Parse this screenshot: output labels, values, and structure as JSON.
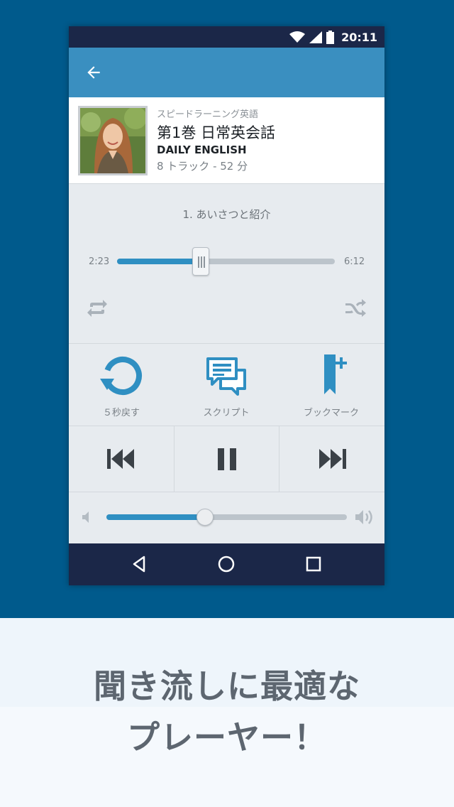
{
  "status_bar": {
    "time": "20:11",
    "icons": [
      "wifi-icon",
      "signal-icon",
      "battery-icon"
    ]
  },
  "app_bar": {
    "back_icon": "arrow-left-icon"
  },
  "album": {
    "series": "スピードラーニング英語",
    "title": "第1巻 日常英会話",
    "subtitle": "DAILY ENGLISH",
    "meta": "8 トラック - 52 分"
  },
  "player": {
    "track_name": "1. あいさつと紹介",
    "elapsed": "2:23",
    "total": "6:12",
    "progress_fraction": 0.385,
    "volume_fraction": 0.41,
    "repeat_icon": "repeat-icon",
    "shuffle_icon": "shuffle-icon"
  },
  "actions": [
    {
      "label": "５秒戻す",
      "icon": "replay-5-icon"
    },
    {
      "label": "スクリプト",
      "icon": "script-chat-icon"
    },
    {
      "label": "ブックマーク",
      "icon": "bookmark-add-icon"
    }
  ],
  "transport": {
    "prev_icon": "skip-previous-icon",
    "pause_icon": "pause-icon",
    "next_icon": "skip-next-icon"
  },
  "nav_bar": {
    "icons": [
      "nav-back-icon",
      "nav-home-icon",
      "nav-recents-icon"
    ]
  },
  "promo": {
    "line1": "聞き流しに最適な",
    "line2": "プレーヤー！"
  },
  "colors": {
    "accent": "#2f8fc2",
    "app_bar": "#3a8fc0",
    "status_bar": "#1b2748",
    "background": "#005a8c"
  }
}
